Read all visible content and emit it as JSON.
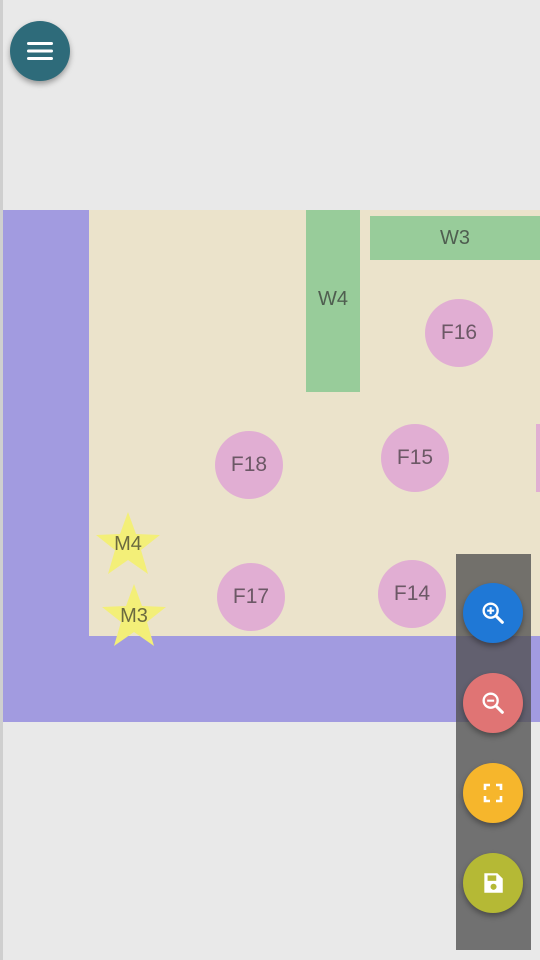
{
  "app": {
    "menu_icon": "hamburger-menu-icon",
    "colors": {
      "page_bg": "#e9e9e9",
      "menu_button": "#2e6b7a",
      "wall": "#a29be0",
      "floor": "#ebe3cb",
      "w_zone": "#98cc9a",
      "f_zone": "#e1aed3",
      "m_marker": "#f3ef78",
      "zoom_in": "#1f78d6",
      "zoom_out": "#e07474",
      "fit": "#f6b62c",
      "save": "#b5b935"
    }
  },
  "map": {
    "w_zones": [
      {
        "id": "w3",
        "label": "W3"
      },
      {
        "id": "w4",
        "label": "W4"
      }
    ],
    "f_zones": [
      {
        "id": "f14",
        "label": "F14"
      },
      {
        "id": "f15",
        "label": "F15"
      },
      {
        "id": "f16",
        "label": "F16"
      },
      {
        "id": "f17",
        "label": "F17"
      },
      {
        "id": "f18",
        "label": "F18"
      }
    ],
    "markers": [
      {
        "id": "m3",
        "label": "M3"
      },
      {
        "id": "m4",
        "label": "M4"
      }
    ]
  },
  "toolbar": {
    "buttons": [
      {
        "id": "zoom-in",
        "icon": "zoom-in-icon"
      },
      {
        "id": "zoom-out",
        "icon": "zoom-out-icon"
      },
      {
        "id": "fit-screen",
        "icon": "fullscreen-icon"
      },
      {
        "id": "save",
        "icon": "save-icon"
      }
    ]
  }
}
